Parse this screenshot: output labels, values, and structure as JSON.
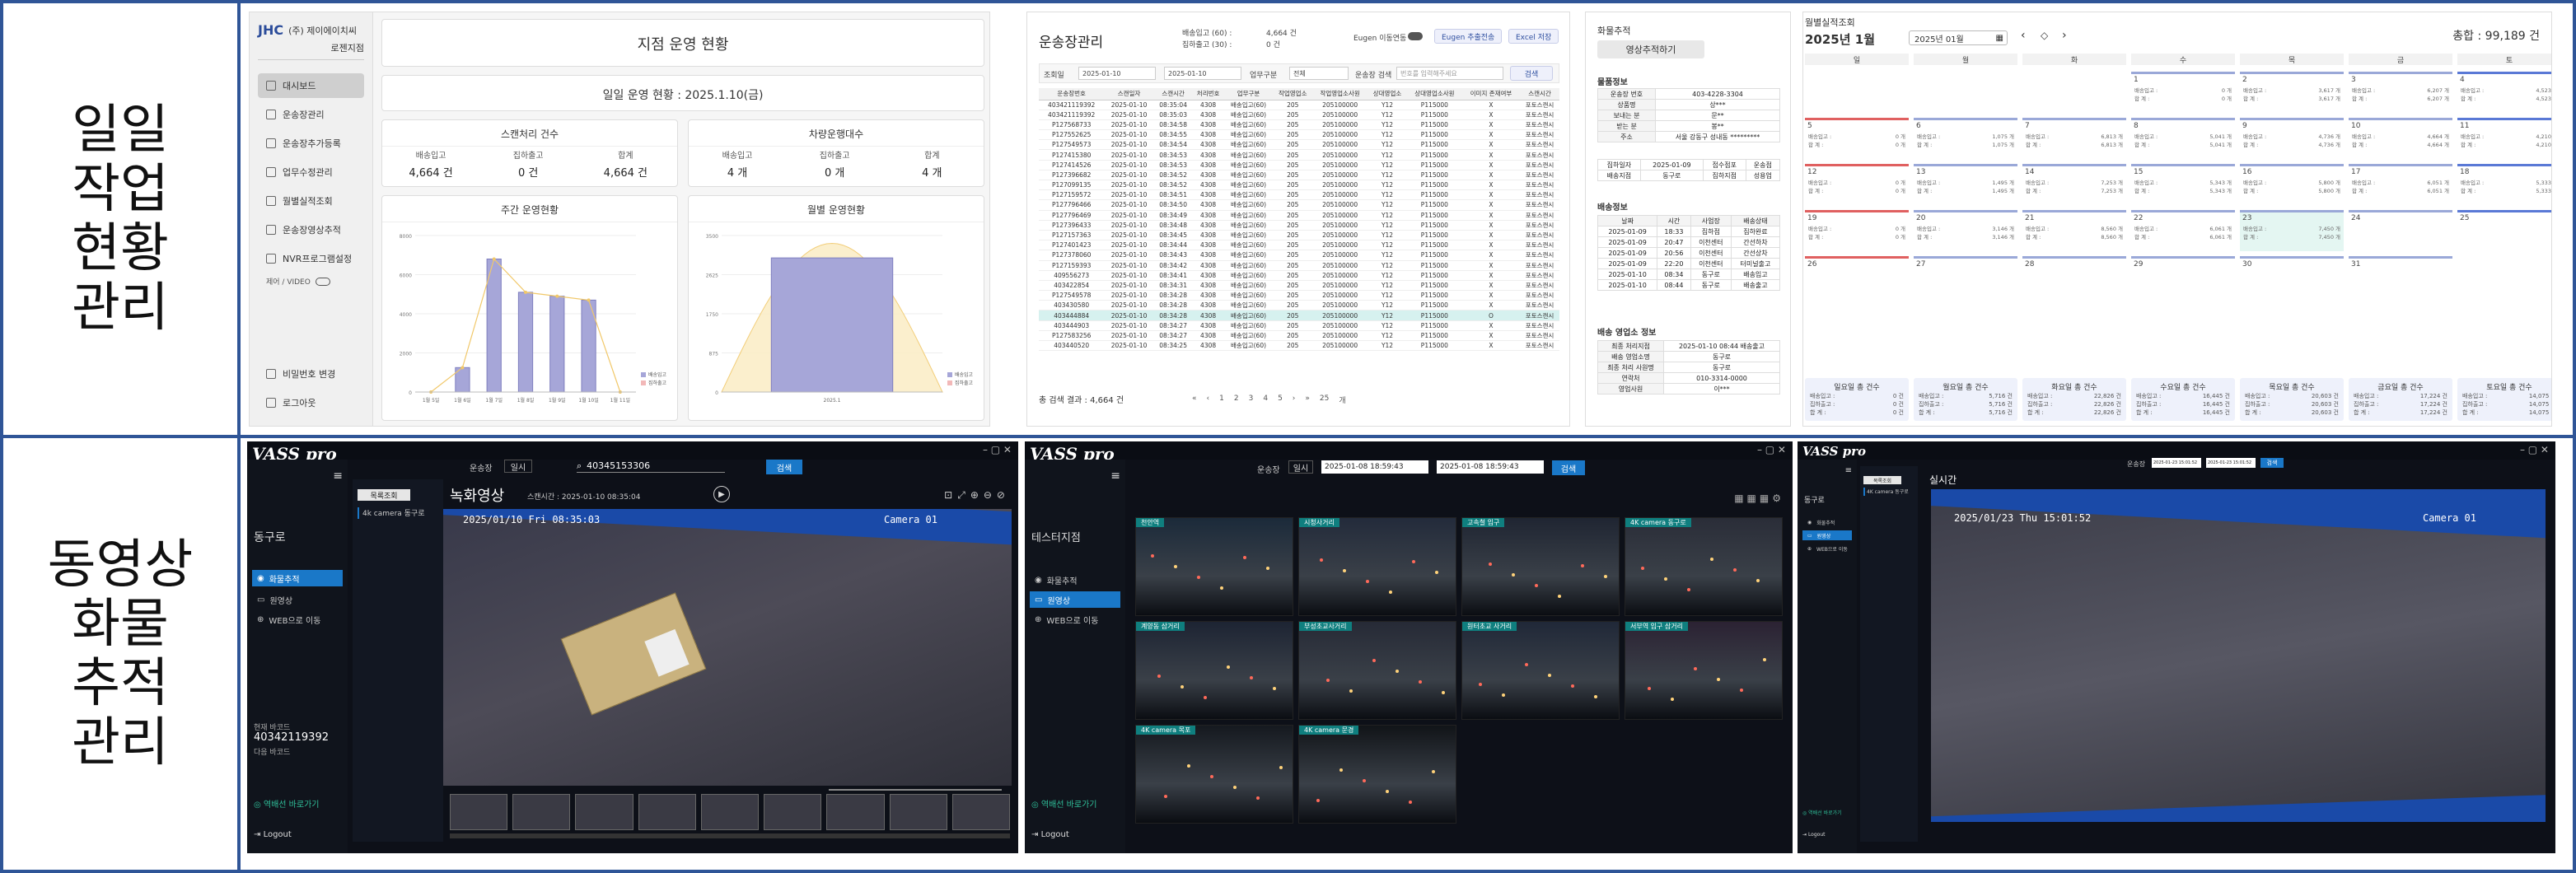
{
  "row_labels": {
    "top": [
      "일일",
      "작업",
      "현황",
      "관리"
    ],
    "bottom": [
      "동영상",
      "화물",
      "추적",
      "관리"
    ]
  },
  "dashboard": {
    "company": "(주) 제이에이치씨",
    "branch": "로젠지점",
    "menu": [
      "대시보드",
      "운송장관리",
      "운송장추가등록",
      "업무수정관리",
      "월별실적조회",
      "운송장영상추적",
      "NVR프로그램설정"
    ],
    "menu_active": 0,
    "toggle_label": "제어 / VIDEO",
    "footer": [
      "비밀번호 변경",
      "로그아웃"
    ],
    "title": "지점 운영 현황",
    "subtitle": "일일 운영 현황 : 2025.1.10(금)",
    "kpi_left_title": "스캔처리 건수",
    "kpi_right_title": "차량운행대수",
    "kpi_left": [
      {
        "label": "배송입고",
        "value": "4,664 건"
      },
      {
        "label": "집하출고",
        "value": "0 건"
      },
      {
        "label": "합계",
        "value": "4,664 건"
      }
    ],
    "kpi_right": [
      {
        "label": "배송입고",
        "value": "4 개"
      },
      {
        "label": "집하출고",
        "value": "0 개"
      },
      {
        "label": "합계",
        "value": "4 개"
      }
    ],
    "weekly_title": "주간 운영현황",
    "monthly_title": "월별 운영현황"
  },
  "chart_data": [
    {
      "type": "bar",
      "title": "주간 운영현황",
      "categories": [
        "1월 5일",
        "1월 6일",
        "1월 7일",
        "1월 8일",
        "1월 9일",
        "1월 10일",
        "1월 11일"
      ],
      "series": [
        {
          "name": "배송입고",
          "values": [
            0,
            1250,
            6800,
            5100,
            4900,
            4700,
            0
          ]
        },
        {
          "name": "집하출고",
          "values": [
            0,
            0,
            0,
            0,
            0,
            0,
            0
          ]
        }
      ],
      "ylim": [
        0,
        8000
      ]
    },
    {
      "type": "bar",
      "title": "월별 운영현황",
      "categories": [
        "2025.1"
      ],
      "series": [
        {
          "name": "배송입고",
          "values": [
            3000
          ]
        },
        {
          "name": "집하출고",
          "values": [
            0
          ]
        }
      ],
      "ylim": [
        0,
        3500
      ]
    }
  ],
  "waybill": {
    "title": "운송장관리",
    "stats": [
      "배송입고 (60) :",
      "4,664 건",
      "집하출고 (30) :",
      "0 건"
    ],
    "eugen_label": "Eugen 이동연동",
    "buttons": [
      "Eugen 추출전송",
      "Excel 저장"
    ],
    "filter_label": "조회일",
    "date_from": "2025-01-10",
    "date_to": "2025-01-10",
    "type_label": "업무구분",
    "type_value": "전체",
    "search_label": "운송장 검색",
    "search_placeholder": "번호를 입력해주세요",
    "search_btn": "검색",
    "columns": [
      "운송장번호",
      "스캔일자",
      "스캔시간",
      "처리번호",
      "업무구분",
      "작업영업소",
      "작업영업소사원",
      "상대영업소",
      "상대영업소사원",
      "이미지 존재여부",
      "스캔시간"
    ],
    "rows": [
      [
        "403421119392",
        "2025-01-10",
        "08:35:04",
        "4308",
        "배송입고(60)",
        "205",
        "205100000",
        "Y12",
        "P115000",
        "X",
        "포토스캔시"
      ],
      [
        "403421119392",
        "2025-01-10",
        "08:35:03",
        "4308",
        "배송입고(60)",
        "205",
        "205100000",
        "Y12",
        "P115000",
        "X",
        "포토스캔시"
      ],
      [
        "P127568733",
        "2025-01-10",
        "08:34:58",
        "4308",
        "배송입고(60)",
        "205",
        "205100000",
        "Y12",
        "P115000",
        "X",
        "포토스캔시"
      ],
      [
        "P127552625",
        "2025-01-10",
        "08:34:55",
        "4308",
        "배송입고(60)",
        "205",
        "205100000",
        "Y12",
        "P115000",
        "X",
        "포토스캔시"
      ],
      [
        "P127549573",
        "2025-01-10",
        "08:34:54",
        "4308",
        "배송입고(60)",
        "205",
        "205100000",
        "Y12",
        "P115000",
        "X",
        "포토스캔시"
      ],
      [
        "P127415380",
        "2025-01-10",
        "08:34:53",
        "4308",
        "배송입고(60)",
        "205",
        "205100000",
        "Y12",
        "P115000",
        "X",
        "포토스캔시"
      ],
      [
        "P127414526",
        "2025-01-10",
        "08:34:53",
        "4308",
        "배송입고(60)",
        "205",
        "205100000",
        "Y12",
        "P115000",
        "X",
        "포토스캔시"
      ],
      [
        "P127396682",
        "2025-01-10",
        "08:34:52",
        "4308",
        "배송입고(60)",
        "205",
        "205100000",
        "Y12",
        "P115000",
        "X",
        "포토스캔시"
      ],
      [
        "P127099135",
        "2025-01-10",
        "08:34:52",
        "4308",
        "배송입고(60)",
        "205",
        "205100000",
        "Y12",
        "P115000",
        "X",
        "포토스캔시"
      ],
      [
        "P127159572",
        "2025-01-10",
        "08:34:51",
        "4308",
        "배송입고(60)",
        "205",
        "205100000",
        "Y12",
        "P115000",
        "X",
        "포토스캔시"
      ],
      [
        "P127796466",
        "2025-01-10",
        "08:34:50",
        "4308",
        "배송입고(60)",
        "205",
        "205100000",
        "Y12",
        "P115000",
        "X",
        "포토스캔시"
      ],
      [
        "P127796469",
        "2025-01-10",
        "08:34:49",
        "4308",
        "배송입고(60)",
        "205",
        "205100000",
        "Y12",
        "P115000",
        "X",
        "포토스캔시"
      ],
      [
        "P127396433",
        "2025-01-10",
        "08:34:48",
        "4308",
        "배송입고(60)",
        "205",
        "205100000",
        "Y12",
        "P115000",
        "X",
        "포토스캔시"
      ],
      [
        "P127157363",
        "2025-01-10",
        "08:34:45",
        "4308",
        "배송입고(60)",
        "205",
        "205100000",
        "Y12",
        "P115000",
        "X",
        "포토스캔시"
      ],
      [
        "P127401423",
        "2025-01-10",
        "08:34:44",
        "4308",
        "배송입고(60)",
        "205",
        "205100000",
        "Y12",
        "P115000",
        "X",
        "포토스캔시"
      ],
      [
        "P127378060",
        "2025-01-10",
        "08:34:43",
        "4308",
        "배송입고(60)",
        "205",
        "205100000",
        "Y12",
        "P115000",
        "X",
        "포토스캔시"
      ],
      [
        "P127159393",
        "2025-01-10",
        "08:34:42",
        "4308",
        "배송입고(60)",
        "205",
        "205100000",
        "Y12",
        "P115000",
        "X",
        "포토스캔시"
      ],
      [
        "409556273",
        "2025-01-10",
        "08:34:41",
        "4308",
        "배송입고(60)",
        "205",
        "205100000",
        "Y12",
        "P115000",
        "X",
        "포토스캔시"
      ],
      [
        "403422854",
        "2025-01-10",
        "08:34:31",
        "4308",
        "배송입고(60)",
        "205",
        "205100000",
        "Y12",
        "P115000",
        "X",
        "포토스캔시"
      ],
      [
        "P127549578",
        "2025-01-10",
        "08:34:28",
        "4308",
        "배송입고(60)",
        "205",
        "205100000",
        "Y12",
        "P115000",
        "X",
        "포토스캔시"
      ],
      [
        "403430580",
        "2025-01-10",
        "08:34:28",
        "4308",
        "배송입고(60)",
        "205",
        "205100000",
        "Y12",
        "P115000",
        "X",
        "포토스캔시"
      ],
      [
        "403444884",
        "2025-01-10",
        "08:34:28",
        "4308",
        "배송입고(60)",
        "205",
        "205100000",
        "Y12",
        "P115000",
        "O",
        "포토스캔시"
      ],
      [
        "403444903",
        "2025-01-10",
        "08:34:27",
        "4308",
        "배송입고(60)",
        "205",
        "205100000",
        "Y12",
        "P115000",
        "X",
        "포토스캔시"
      ],
      [
        "P127583256",
        "2025-01-10",
        "08:34:27",
        "4308",
        "배송입고(60)",
        "205",
        "205100000",
        "Y12",
        "P115000",
        "X",
        "포토스캔시"
      ],
      [
        "403440520",
        "2025-01-10",
        "08:34:25",
        "4308",
        "배송입고(60)",
        "205",
        "205100000",
        "Y12",
        "P115000",
        "X",
        "포토스캔시"
      ]
    ],
    "highlight_row": 21,
    "total": "총 검색 결과 : 4,664 건",
    "pager": [
      "«",
      "‹",
      "1",
      "2",
      "3",
      "4",
      "5",
      "›",
      "»",
      "25",
      "개"
    ]
  },
  "tracking": {
    "title": "화물추적",
    "video_btn": "영상추적하기",
    "cargo_title": "물품정보",
    "cargo": [
      [
        "운송장 번호",
        "403-4228-3304"
      ],
      [
        "상품명",
        "상***"
      ],
      [
        "보내는 분",
        "문**"
      ],
      [
        "받는 분",
        "봉**"
      ],
      [
        "주소",
        "서울 강동구 성내동 *********"
      ]
    ],
    "cargo_extra": [
      "집하일자",
      "2025-01-09",
      "접수점포",
      "운송점",
      "배송지점",
      "동구로",
      "집하지점",
      "성용업"
    ],
    "delivery_title": "배송정보",
    "delivery_cols": [
      "날짜",
      "시간",
      "사업장",
      "배송상태"
    ],
    "delivery_rows": [
      [
        "2025-01-09",
        "18:33",
        "집하점",
        "집하완료"
      ],
      [
        "2025-01-09",
        "20:47",
        "이천센터",
        "간선하차"
      ],
      [
        "2025-01-09",
        "20:56",
        "이천센터",
        "간선상차"
      ],
      [
        "2025-01-09",
        "22:20",
        "이천센터",
        "터미널출고"
      ],
      [
        "2025-01-10",
        "08:34",
        "동구로",
        "배송입고"
      ],
      [
        "2025-01-10",
        "08:44",
        "동구로",
        "배송출고"
      ]
    ],
    "office_title": "배송 영업소 정보",
    "office": [
      [
        "최종 처리지점",
        "2025-01-10 08:44 배송출고"
      ],
      [
        "배송 영업소명",
        "동구로"
      ],
      [
        "최종 처리 사원명",
        "동구로"
      ],
      [
        "연락처",
        "010-3314-0000"
      ],
      [
        "영업사원",
        "이***"
      ]
    ]
  },
  "calendar": {
    "title": "월별실적조회",
    "month": "2025년 1월",
    "picker": "2025년 01월",
    "total": "총합 : 99,189 건",
    "weekdays": [
      "일",
      "월",
      "화",
      "수",
      "목",
      "금",
      "토"
    ],
    "weeks": [
      [
        null,
        null,
        null,
        {
          "d": "1",
          "a": "0 개",
          "b": "0 개"
        },
        {
          "d": "2",
          "a": "3,617 개",
          "b": "3,617 개"
        },
        {
          "d": "3",
          "a": "6,207 개",
          "b": "6,207 개"
        },
        {
          "d": "4",
          "a": "4,523 개",
          "b": "4,523 개"
        }
      ],
      [
        {
          "d": "5",
          "a": "0 개",
          "b": "0 개"
        },
        {
          "d": "6",
          "a": "1,075 개",
          "b": "1,075 개"
        },
        {
          "d": "7",
          "a": "6,813 개",
          "b": "6,813 개"
        },
        {
          "d": "8",
          "a": "5,041 개",
          "b": "5,041 개"
        },
        {
          "d": "9",
          "a": "4,736 개",
          "b": "4,736 개"
        },
        {
          "d": "10",
          "a": "4,664 개",
          "b": "4,664 개"
        },
        {
          "d": "11",
          "a": "4,210 개",
          "b": "4,210 개"
        }
      ],
      [
        {
          "d": "12",
          "a": "0 개",
          "b": "0 개"
        },
        {
          "d": "13",
          "a": "1,495 개",
          "b": "1,495 개"
        },
        {
          "d": "14",
          "a": "7,253 개",
          "b": "7,253 개"
        },
        {
          "d": "15",
          "a": "5,343 개",
          "b": "5,343 개"
        },
        {
          "d": "16",
          "a": "5,800 개",
          "b": "5,800 개"
        },
        {
          "d": "17",
          "a": "6,051 개",
          "b": "6,051 개"
        },
        {
          "d": "18",
          "a": "5,333 개",
          "b": "5,333 개"
        }
      ],
      [
        {
          "d": "19",
          "a": "0 개",
          "b": "0 개"
        },
        {
          "d": "20",
          "a": "3,146 개",
          "b": "3,146 개"
        },
        {
          "d": "21",
          "a": "8,560 개",
          "b": "8,560 개"
        },
        {
          "d": "22",
          "a": "6,061 개",
          "b": "6,061 개"
        },
        {
          "d": "23",
          "a": "7,450 개",
          "b": "7,450 개",
          "hl": true
        },
        {
          "d": "24",
          "a": "",
          "b": ""
        },
        {
          "d": "25",
          "a": "",
          "b": ""
        }
      ],
      [
        {
          "d": "26",
          "a": "",
          "b": ""
        },
        {
          "d": "27",
          "a": "",
          "b": ""
        },
        {
          "d": "28",
          "a": "",
          "b": ""
        },
        {
          "d": "29",
          "a": "",
          "b": ""
        },
        {
          "d": "30",
          "a": "",
          "b": ""
        },
        {
          "d": "31",
          "a": "",
          "b": ""
        },
        null
      ]
    ],
    "cell_label_a": "배송입고 :",
    "cell_label_b": "합    계 :",
    "summary": [
      {
        "t": "일요일 총 건수",
        "v": "0 건"
      },
      {
        "t": "월요일 총 건수",
        "v": "5,716 건"
      },
      {
        "t": "화요일 총 건수",
        "v": "22,826 건"
      },
      {
        "t": "수요일 총 건수",
        "v": "16,445 건"
      },
      {
        "t": "목요일 총 건수",
        "v": "20,603 건"
      },
      {
        "t": "금요일 총 건수",
        "v": "17,224 건"
      },
      {
        "t": "토요일 총 건수",
        "v": "14,075 건"
      }
    ],
    "summary_labels": [
      "배송입고 :",
      "집하출고 :",
      "합    계 :"
    ]
  },
  "vass1": {
    "logo": "VASS pro",
    "store_label": "운송장",
    "store_value": "일시",
    "search_value": "40345153306",
    "search_btn": "검색",
    "branch": "동구로",
    "menu": [
      "화물추적",
      "원영상",
      "WEB으로 이동"
    ],
    "menu_active": 0,
    "folder_tab": "목록조회",
    "cam_item": "4k camera 동구로",
    "section_title": "녹화영상",
    "scan_time": "스캔시간 : 2025-01-10 08:35:04",
    "osd_time": "2025/01/10 Fri 08:35:03",
    "osd_cam": "Camera 01",
    "current_label": "현재 바코드",
    "current_value": "40342119392",
    "next_label": "다음 바코드",
    "footer": [
      "역배선 바로가기",
      "Logout"
    ]
  },
  "vass2": {
    "logo": "VASS pro",
    "store_label": "운송장",
    "store_value": "일시",
    "date_from": "2025-01-08 18:59:43",
    "date_to": "2025-01-08 18:59:43",
    "search_btn": "검색",
    "branch": "테스터지점",
    "menu": [
      "화물추적",
      "원영상",
      "WEB으로 이동"
    ],
    "menu_active": 1,
    "cams": [
      "천안역",
      "시청사거리",
      "고속철 입구",
      "4K camera 동구로",
      "계양동 삼거리",
      "부성초교사거리",
      "원터초교 사거리",
      "서부역 입구 삼거리",
      "4K camera 목포",
      "4K camera 문경"
    ],
    "footer": [
      "역배선 바로가기",
      "Logout"
    ]
  },
  "vass3": {
    "logo": "VASS pro",
    "label": "운송장",
    "date_from": "2025-01-23 15:01:52",
    "date_to": "2025-01-23 15:01:52",
    "search_btn": "검색",
    "branch": "동구로",
    "menu": [
      "화물추적",
      "원영상",
      "WEB으로 이동"
    ],
    "menu_active": 1,
    "folder_tab": "목록조회",
    "cam_item": "4K camera 동구로",
    "section_title": "실시간",
    "osd_time": "2025/01/23 Thu 15:01:52",
    "osd_cam": "Camera 01",
    "footer": [
      "역배선 바로가기",
      "Logout"
    ]
  }
}
